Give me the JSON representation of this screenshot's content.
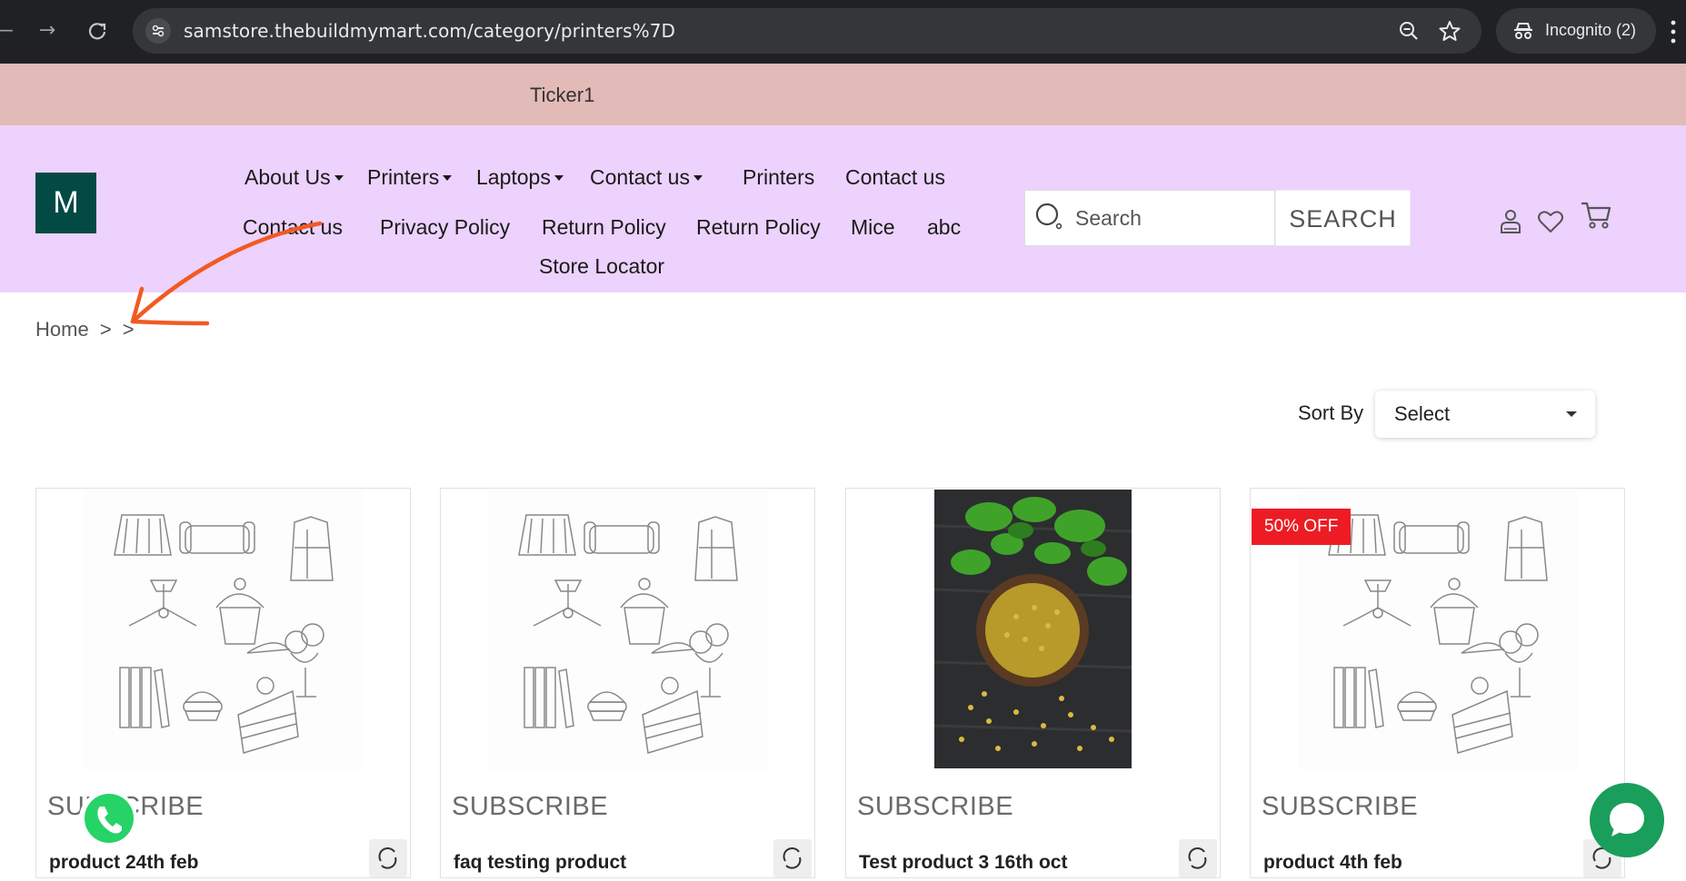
{
  "browser": {
    "url": "samstore.thebuildmymart.com/category/printers%7D",
    "incognito_label": "Incognito (2)"
  },
  "ticker": {
    "text": "Ticker1"
  },
  "header": {
    "logo_text": "M",
    "menu_row1": [
      {
        "label": "About Us",
        "dropdown": true
      },
      {
        "label": "Printers",
        "dropdown": true
      },
      {
        "label": "Laptops",
        "dropdown": true
      },
      {
        "label": "Contact us",
        "dropdown": true
      },
      {
        "label": "Printers",
        "dropdown": false
      },
      {
        "label": "Contact us",
        "dropdown": false
      }
    ],
    "menu_row2": [
      {
        "label": "Contact us"
      },
      {
        "label": "Privacy Policy"
      },
      {
        "label": "Return Policy"
      },
      {
        "label": "Return Policy"
      },
      {
        "label": "Mice"
      },
      {
        "label": "abc"
      }
    ],
    "menu_row3": [
      {
        "label": "Store Locator"
      }
    ],
    "search_placeholder": "Search",
    "search_button": "SEARCH",
    "bg_color": "#ecd2fd"
  },
  "breadcrumb": {
    "home": "Home",
    "sep1": ">",
    "sep2": ">"
  },
  "sort": {
    "label": "Sort By",
    "selected": "Select"
  },
  "products": [
    {
      "subscribe": "SUBSCRIBE",
      "name": "product 24th feb",
      "image": "placeholder",
      "badge": ""
    },
    {
      "subscribe": "SUBSCRIBE",
      "name": "faq testing product",
      "image": "placeholder",
      "badge": ""
    },
    {
      "subscribe": "SUBSCRIBE",
      "name": "Test product 3 16th oct",
      "image": "photo",
      "badge": ""
    },
    {
      "subscribe": "SUBSCRIBE",
      "name": "product 4th feb",
      "image": "placeholder",
      "badge": "50% OFF"
    }
  ],
  "colors": {
    "ticker_bg": "#e2bab7",
    "logo_bg": "#034a44",
    "badge_bg": "#ed1c24",
    "chat_bg": "#1a9e5b",
    "annotation": "#f15a22"
  }
}
